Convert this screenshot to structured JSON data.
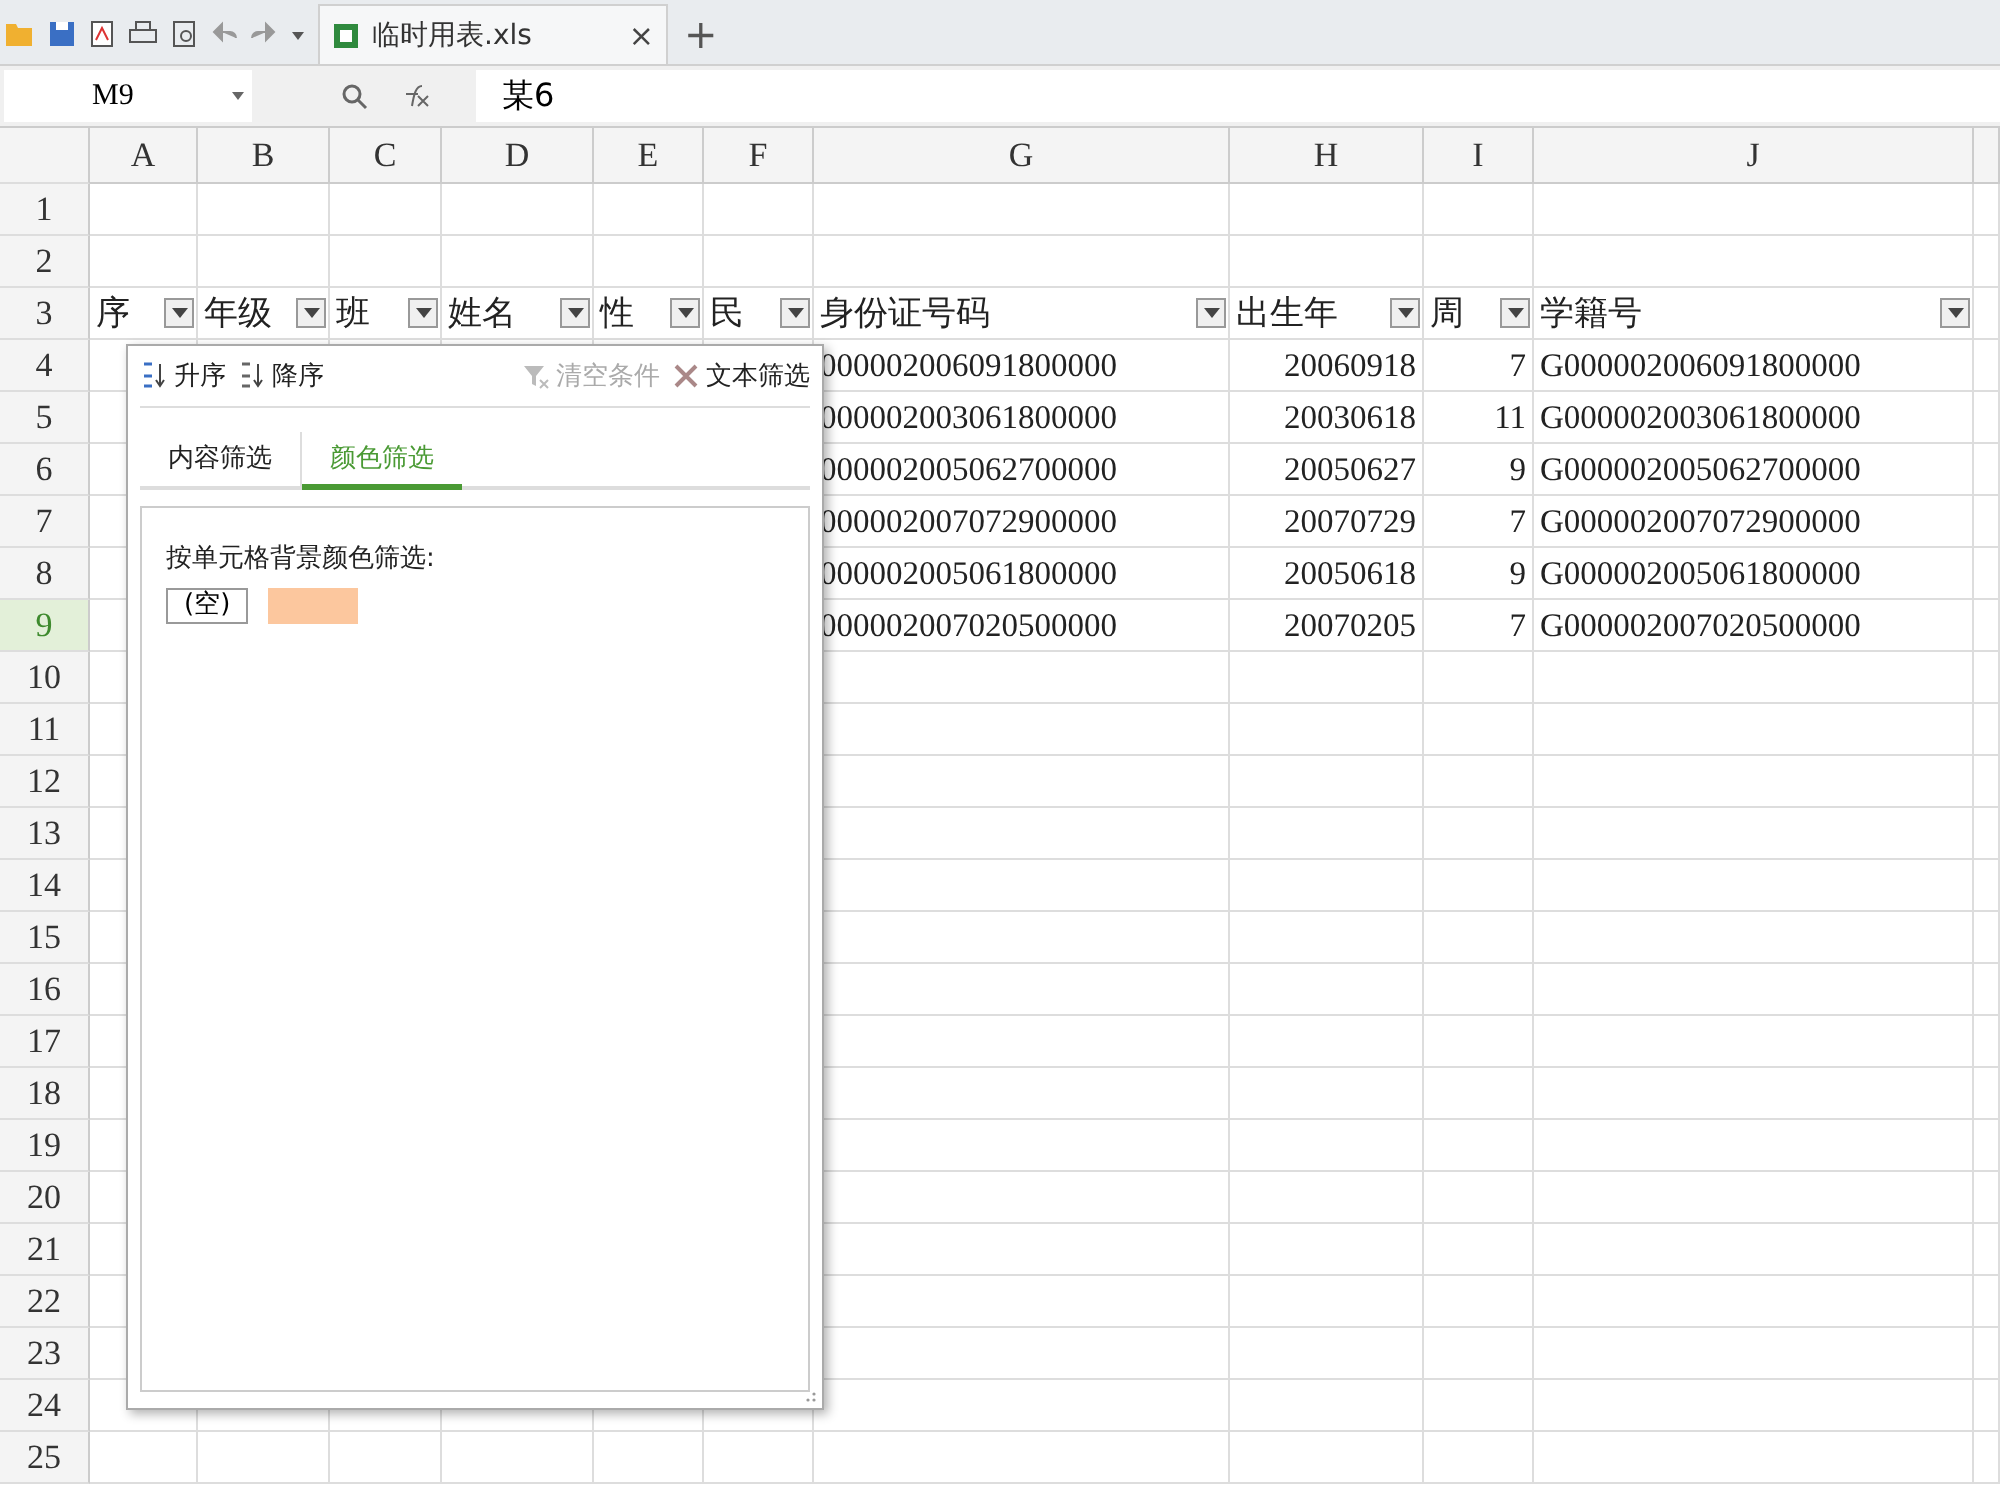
{
  "toolbar": {
    "file_tab": {
      "title": "临时用表.xls",
      "close": "×"
    },
    "new_tab": "+"
  },
  "formula_bar": {
    "cell_ref": "M9",
    "formula": "某6"
  },
  "sheet": {
    "columns": [
      {
        "letter": "A",
        "header": "序"
      },
      {
        "letter": "B",
        "header": "年级"
      },
      {
        "letter": "C",
        "header": "班"
      },
      {
        "letter": "D",
        "header": "姓名"
      },
      {
        "letter": "E",
        "header": "性"
      },
      {
        "letter": "F",
        "header": "民"
      },
      {
        "letter": "G",
        "header": "身份证号码"
      },
      {
        "letter": "H",
        "header": "出生年"
      },
      {
        "letter": "I",
        "header": "周"
      },
      {
        "letter": "J",
        "header": "学籍号"
      }
    ],
    "rows": [
      {
        "number": "1",
        "selected": false
      },
      {
        "number": "2",
        "selected": false
      },
      {
        "number": "3",
        "selected": false
      },
      {
        "number": "4",
        "selected": false
      },
      {
        "number": "5",
        "selected": false
      },
      {
        "number": "6",
        "selected": false
      },
      {
        "number": "7",
        "selected": false
      },
      {
        "number": "8",
        "selected": false
      },
      {
        "number": "9",
        "selected": true
      },
      {
        "number": "10",
        "selected": false
      },
      {
        "number": "11",
        "selected": false
      },
      {
        "number": "12",
        "selected": false
      },
      {
        "number": "13",
        "selected": false
      },
      {
        "number": "14",
        "selected": false
      },
      {
        "number": "15",
        "selected": false
      },
      {
        "number": "16",
        "selected": false
      },
      {
        "number": "17",
        "selected": false
      },
      {
        "number": "18",
        "selected": false
      },
      {
        "number": "19",
        "selected": false
      },
      {
        "number": "20",
        "selected": false
      },
      {
        "number": "21",
        "selected": false
      },
      {
        "number": "22",
        "selected": false
      },
      {
        "number": "23",
        "selected": false
      },
      {
        "number": "24",
        "selected": false
      },
      {
        "number": "25",
        "selected": false
      }
    ],
    "records": [
      {
        "id_number": "000002006091800000",
        "birth": "20060918",
        "age": "7",
        "student_no": "G000002006091800000"
      },
      {
        "id_number": "000002003061800000",
        "birth": "20030618",
        "age": "11",
        "student_no": "G000002003061800000"
      },
      {
        "id_number": "000002005062700000",
        "birth": "20050627",
        "age": "9",
        "student_no": "G000002005062700000"
      },
      {
        "id_number": "000002007072900000",
        "birth": "20070729",
        "age": "7",
        "student_no": "G000002007072900000"
      },
      {
        "id_number": "000002005061800000",
        "birth": "20050618",
        "age": "9",
        "student_no": "G000002005061800000"
      },
      {
        "id_number": "000002007020500000",
        "birth": "20070205",
        "age": "7",
        "student_no": "G000002007020500000"
      }
    ]
  },
  "filter_popup": {
    "actions": [
      {
        "kind": "sort-asc",
        "label": "升序",
        "disabled": false
      },
      {
        "kind": "sort-desc",
        "label": "降序",
        "disabled": false
      },
      {
        "kind": "clear",
        "label": "清空条件",
        "disabled": true
      },
      {
        "kind": "text-filter",
        "label": "文本筛选",
        "disabled": false
      }
    ],
    "tabs": [
      {
        "label": "内容筛选",
        "selected": false
      },
      {
        "label": "颜色筛选",
        "selected": true
      }
    ],
    "prompt": "按单元格背景颜色筛选:",
    "options": [
      {
        "kind": "blank",
        "label": "(空)"
      },
      {
        "kind": "color",
        "color": "#fcc79e"
      }
    ]
  }
}
